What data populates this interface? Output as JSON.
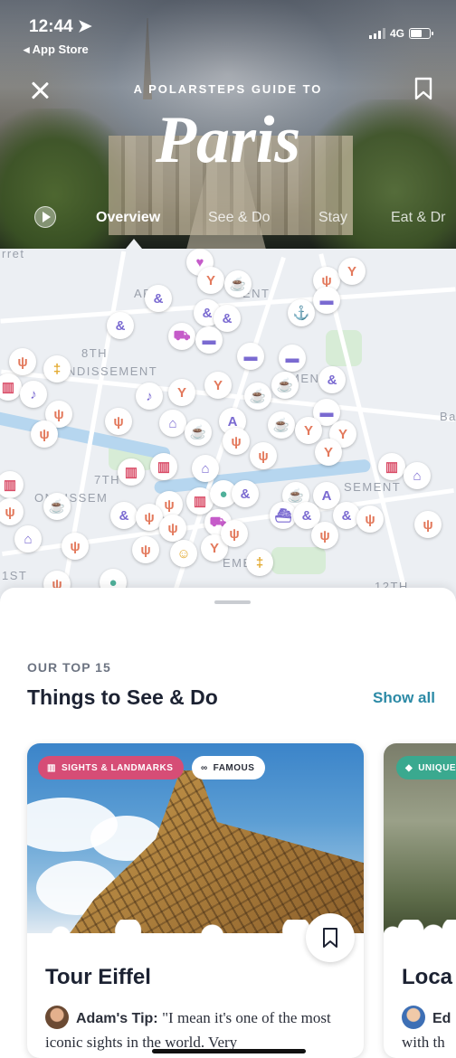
{
  "status_bar": {
    "time": "12:44",
    "back_label": "◂ App Store",
    "network": "4G"
  },
  "header": {
    "guide_label": "A POLARSTEPS GUIDE TO",
    "city": "Paris",
    "tabs": [
      {
        "label": "Overview",
        "active": true
      },
      {
        "label": "See & Do",
        "active": false
      },
      {
        "label": "Stay",
        "active": false
      },
      {
        "label": "Eat & Dr",
        "active": false
      }
    ]
  },
  "map": {
    "labels": [
      "rret",
      "ARR",
      "ENT",
      "8TH",
      "NDISSEMENT",
      "MEN",
      "Ba",
      "7TH",
      "ONDISSEM",
      "SEMENT",
      "EME",
      "12TH",
      "1ST"
    ]
  },
  "section": {
    "kicker": "OUR TOP 15",
    "title": "Things to See & Do",
    "show_all": "Show all"
  },
  "cards": [
    {
      "tags": [
        "SIGHTS & LANDMARKS",
        "FAMOUS"
      ],
      "title": "Tour Eiffel",
      "tip_author": "Adam's Tip:",
      "tip_text": "\"I mean it's one of the most iconic sights in the world. Very"
    },
    {
      "tags": [
        "UNIQUE"
      ],
      "title": "Loca",
      "tip_author": "Ed",
      "tip_text": "with th"
    }
  ],
  "colors": {
    "accent": "#2c8aa6",
    "sights_tag": "#d64d76",
    "unique_tag": "#3aa98f"
  }
}
